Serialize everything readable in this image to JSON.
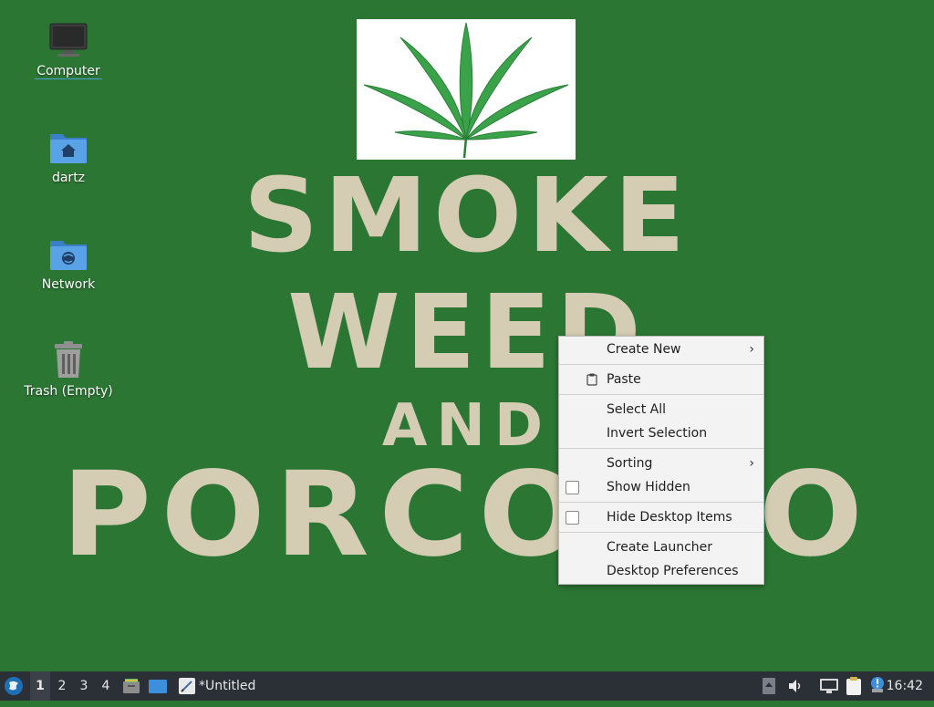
{
  "wallpaper": {
    "line1": "SMOKE",
    "line2": "WEED",
    "line3": "AND",
    "line4": "PORCODIO"
  },
  "desktop_icons": {
    "computer": "Computer",
    "home": "dartz",
    "network": "Network",
    "trash": "Trash (Empty)"
  },
  "context_menu": {
    "create_new": "Create New",
    "paste": "Paste",
    "select_all": "Select All",
    "invert_selection": "Invert Selection",
    "sorting": "Sorting",
    "show_hidden": "Show Hidden",
    "hide_desktop_items": "Hide Desktop Items",
    "create_launcher": "Create Launcher",
    "desktop_preferences": "Desktop Preferences"
  },
  "panel": {
    "workspaces": [
      "1",
      "2",
      "3",
      "4"
    ],
    "active_workspace": "1",
    "task_title": "*Untitled",
    "clock": "16:42"
  },
  "colors": {
    "desktop_bg": "#2c7634",
    "wallpaper_text": "#d4cdb3",
    "panel_bg": "#2b2f36",
    "menu_bg": "#f3f3f3",
    "folder_blue": "#4a90d9"
  },
  "icons": [
    "computer-icon",
    "home-folder-icon",
    "network-folder-icon",
    "trash-icon",
    "start-menu-icon",
    "file-manager-icon",
    "desktop-icon",
    "text-editor-icon",
    "volume-icon",
    "network-icon",
    "clipboard-icon",
    "notification-icon",
    "paste-icon"
  ]
}
